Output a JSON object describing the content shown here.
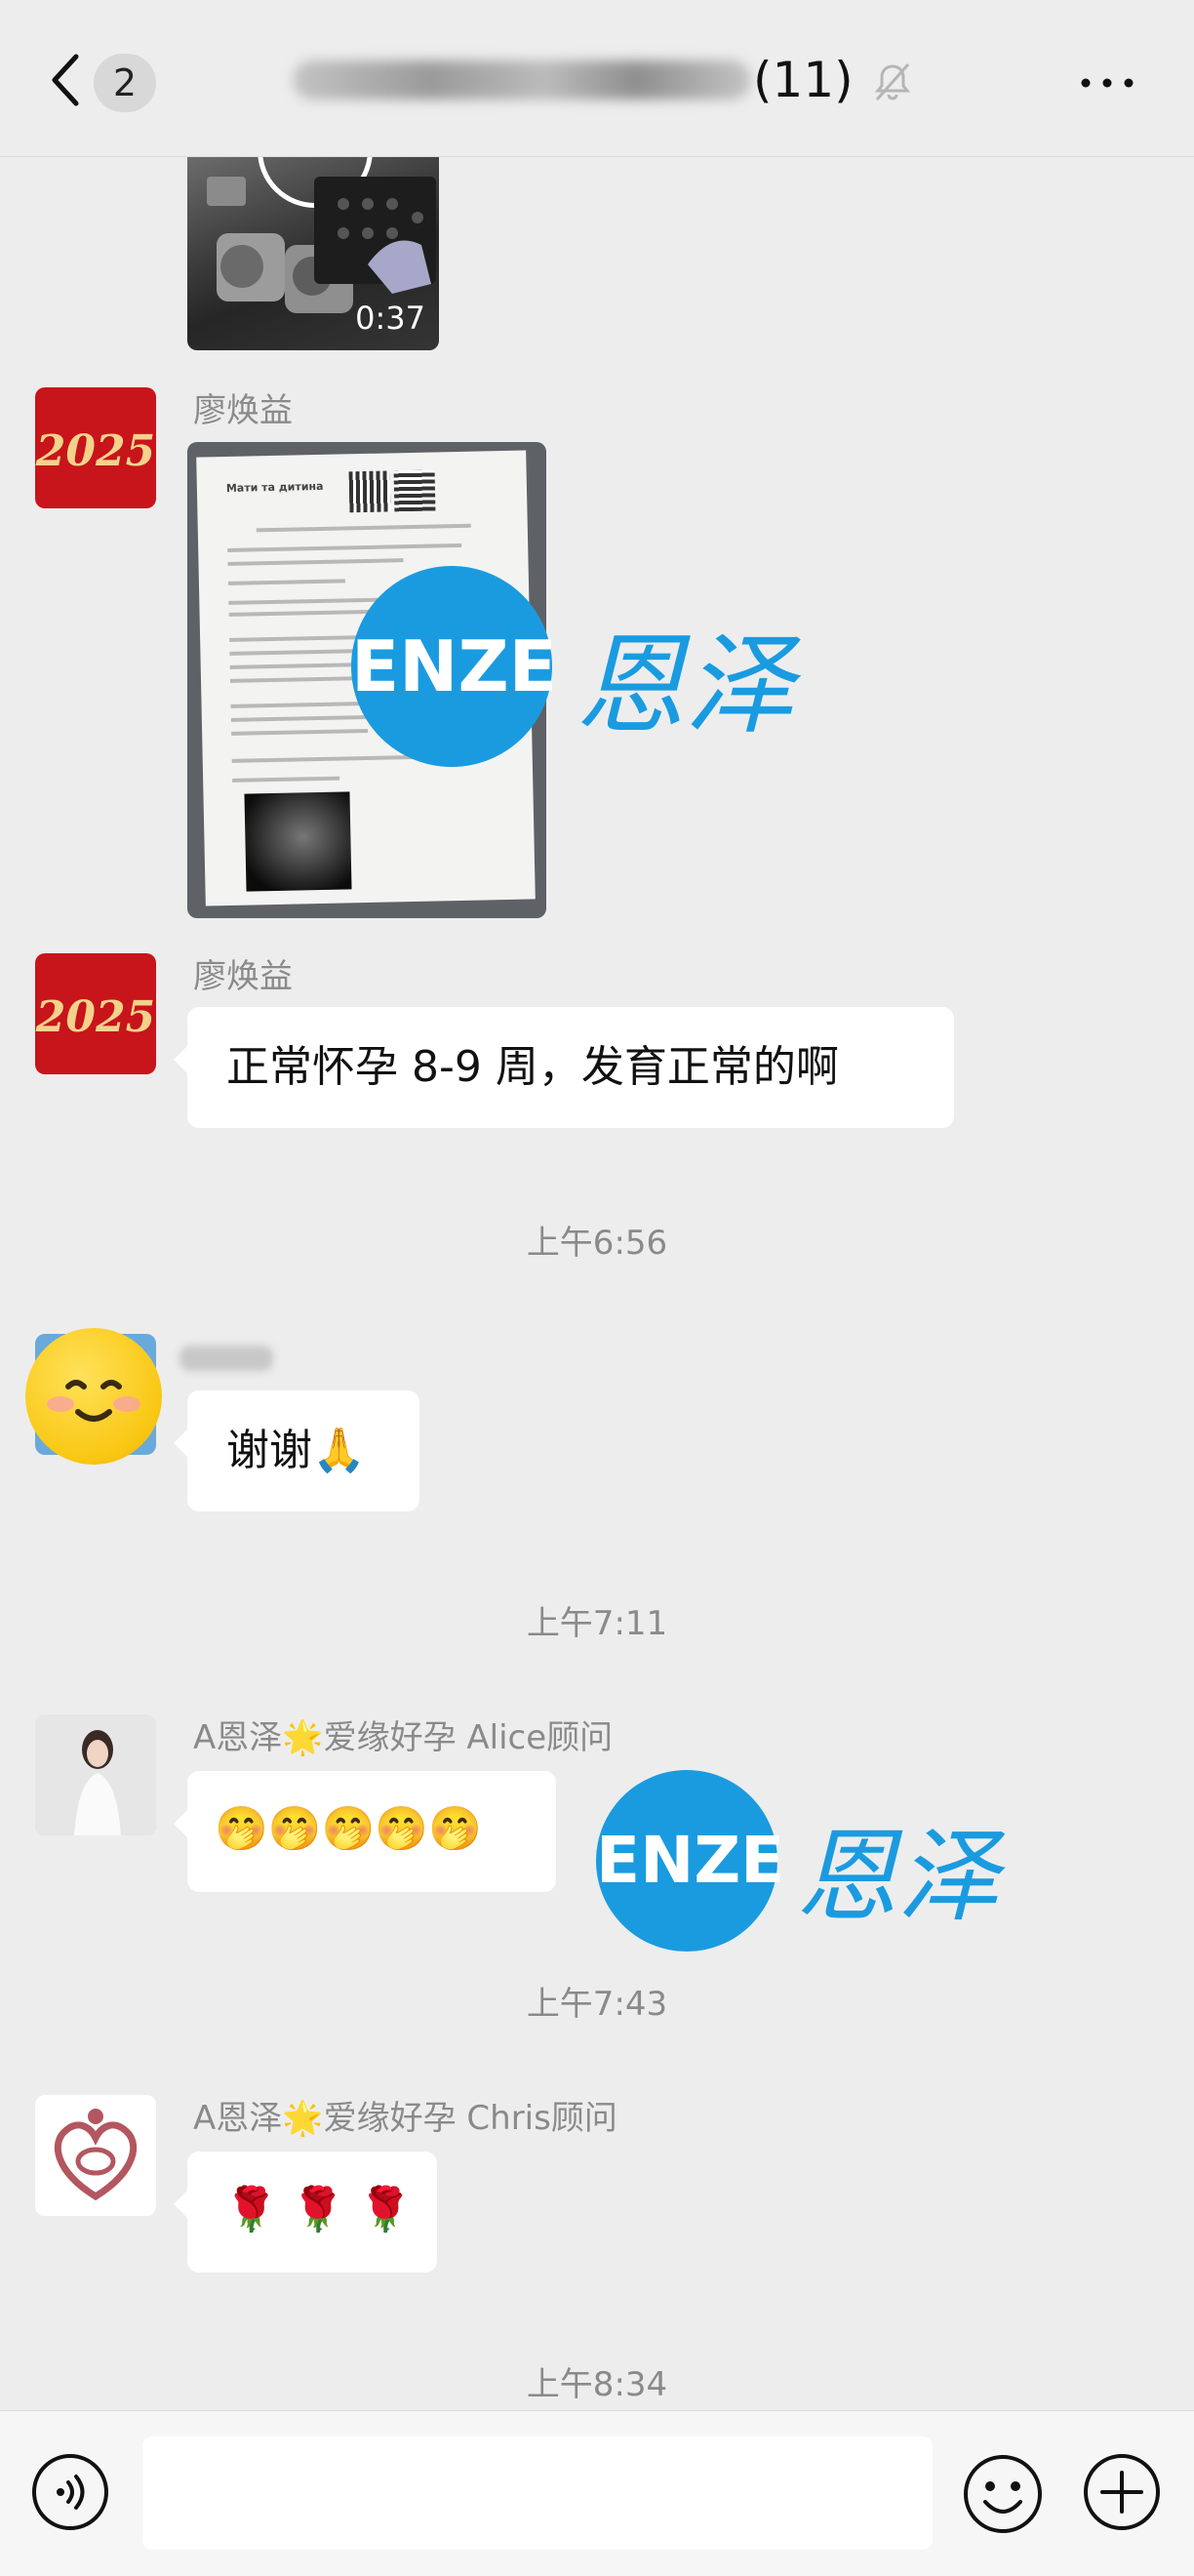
{
  "header": {
    "unread_count": "2",
    "member_count": "(11)"
  },
  "messages": {
    "video_duration": "0:37",
    "liao_name": "廖焕益",
    "liao_text": "正常怀孕 8-9 周，发育正常的啊",
    "avatar_2025_text": "2025",
    "time_1": "上午6:56",
    "thanks_text": "谢谢🙏",
    "time_2": "上午7:11",
    "alice_name": "A恩泽🌟爱缘好孕 Alice顾问",
    "alice_text": "🤭🤭🤭🤭🤭",
    "time_3": "上午7:43",
    "chris_name": "A恩泽🌟爱缘好孕 Chris顾问",
    "chris_text": "🌹 🌹 🌹",
    "time_4": "上午8:34"
  },
  "document_image": {
    "header_text": "Мати та дитина"
  },
  "watermark": {
    "latin": "ENZE",
    "chinese": "恩泽"
  },
  "input": {
    "value": ""
  },
  "icons": {
    "back": "chevron-left-icon",
    "mute": "bell-muted-icon",
    "more": "more-dots-icon",
    "voice": "voice-icon",
    "emoji": "emoji-icon",
    "plus": "plus-icon"
  },
  "colors": {
    "background": "#ededed",
    "bubble": "#ffffff",
    "watermark_blue": "#1a9be0",
    "avatar_red": "#c8141b"
  }
}
